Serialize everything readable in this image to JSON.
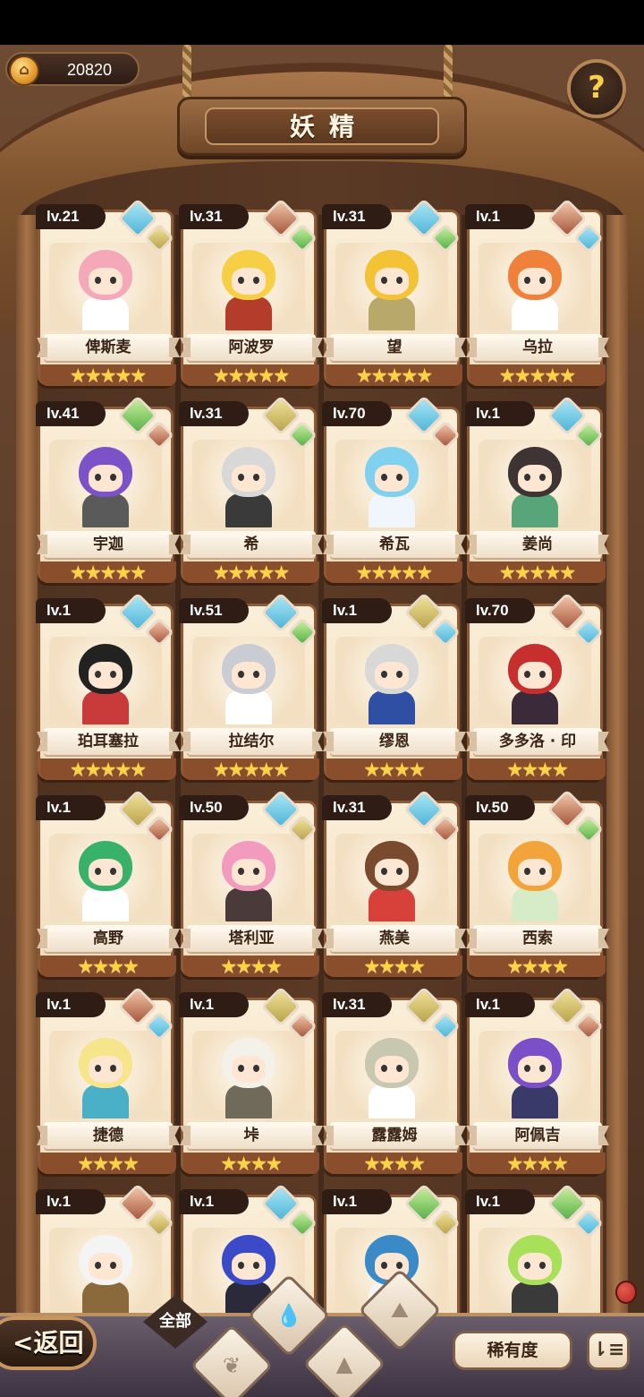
{
  "currency": {
    "value": "20820",
    "icon": "home-coin-icon"
  },
  "title": "妖精",
  "help": {
    "icon": "question-icon",
    "glyph": "?"
  },
  "cards": [
    {
      "lv": "lv.21",
      "name": "俾斯麦",
      "stars": 5,
      "elems": [
        "water",
        "earth"
      ],
      "hair": "#f4a8b8",
      "outfit": "#ffffff"
    },
    {
      "lv": "lv.31",
      "name": "阿波罗",
      "stars": 5,
      "elems": [
        "fire",
        "plant"
      ],
      "hair": "#f6cf45",
      "outfit": "#b33d2a"
    },
    {
      "lv": "lv.31",
      "name": "望",
      "stars": 5,
      "elems": [
        "water",
        "plant"
      ],
      "hair": "#f4c235",
      "outfit": "#b8a86a"
    },
    {
      "lv": "lv.1",
      "name": "乌拉",
      "stars": 5,
      "elems": [
        "fire",
        "water"
      ],
      "hair": "#f0813a",
      "outfit": "#ffffff"
    },
    {
      "lv": "lv.41",
      "name": "宇迦",
      "stars": 5,
      "elems": [
        "plant",
        "fire"
      ],
      "hair": "#7c52c8",
      "outfit": "#5a5a5a"
    },
    {
      "lv": "lv.31",
      "name": "希",
      "stars": 5,
      "elems": [
        "earth",
        "plant"
      ],
      "hair": "#d8d8d8",
      "outfit": "#3a3a3a"
    },
    {
      "lv": "lv.70",
      "name": "希瓦",
      "stars": 5,
      "elems": [
        "water",
        "fire"
      ],
      "hair": "#7fd1ef",
      "outfit": "#f0f6fb"
    },
    {
      "lv": "lv.1",
      "name": "姜尚",
      "stars": 5,
      "elems": [
        "water",
        "plant"
      ],
      "hair": "#3d3433",
      "outfit": "#58a57a"
    },
    {
      "lv": "lv.1",
      "name": "珀耳塞拉",
      "stars": 5,
      "elems": [
        "water",
        "fire"
      ],
      "hair": "#222222",
      "outfit": "#c93a3a"
    },
    {
      "lv": "lv.51",
      "name": "拉结尔",
      "stars": 5,
      "elems": [
        "water",
        "plant"
      ],
      "hair": "#c9ccd3",
      "outfit": "#ffffff"
    },
    {
      "lv": "lv.1",
      "name": "缪恩",
      "stars": 4,
      "elems": [
        "earth",
        "water"
      ],
      "hair": "#d8d8d8",
      "outfit": "#2e4fa3"
    },
    {
      "lv": "lv.70",
      "name": "多多洛 · 印",
      "stars": 4,
      "elems": [
        "fire",
        "water"
      ],
      "hair": "#c72e2e",
      "outfit": "#3a2a3a"
    },
    {
      "lv": "lv.1",
      "name": "高野",
      "stars": 4,
      "elems": [
        "earth",
        "fire"
      ],
      "hair": "#38b26b",
      "outfit": "#ffffff"
    },
    {
      "lv": "lv.50",
      "name": "塔利亚",
      "stars": 4,
      "elems": [
        "water",
        "earth"
      ],
      "hair": "#f29bbf",
      "outfit": "#4a3a3a"
    },
    {
      "lv": "lv.31",
      "name": "燕美",
      "stars": 4,
      "elems": [
        "water",
        "fire"
      ],
      "hair": "#7a4a2f",
      "outfit": "#d8403a"
    },
    {
      "lv": "lv.50",
      "name": "西索",
      "stars": 4,
      "elems": [
        "fire",
        "plant"
      ],
      "hair": "#f2a43a",
      "outfit": "#d6ecc8"
    },
    {
      "lv": "lv.1",
      "name": "捷德",
      "stars": 4,
      "elems": [
        "fire",
        "water"
      ],
      "hair": "#f6e58a",
      "outfit": "#4ab0c8"
    },
    {
      "lv": "lv.1",
      "name": "垰",
      "stars": 4,
      "elems": [
        "earth",
        "fire"
      ],
      "hair": "#f4f1e8",
      "outfit": "#6f6a5a"
    },
    {
      "lv": "lv.31",
      "name": "露露姆",
      "stars": 4,
      "elems": [
        "earth",
        "water"
      ],
      "hair": "#c8c7b0",
      "outfit": "#ffffff"
    },
    {
      "lv": "lv.1",
      "name": "阿佩吉",
      "stars": 4,
      "elems": [
        "earth",
        "fire"
      ],
      "hair": "#7a4fc8",
      "outfit": "#3a3a6a"
    },
    {
      "lv": "lv.1",
      "name": "",
      "stars": 0,
      "elems": [
        "fire",
        "earth"
      ],
      "hair": "#f4f4f4",
      "outfit": "#8a6a3a"
    },
    {
      "lv": "lv.1",
      "name": "",
      "stars": 0,
      "elems": [
        "water",
        "plant"
      ],
      "hair": "#3a4ac8",
      "outfit": "#2a2a3a"
    },
    {
      "lv": "lv.1",
      "name": "",
      "stars": 0,
      "elems": [
        "plant",
        "earth"
      ],
      "hair": "#3a8ac8",
      "outfit": "#f4f4f4"
    },
    {
      "lv": "lv.1",
      "name": "",
      "stars": 0,
      "elems": [
        "plant",
        "water"
      ],
      "hair": "#a8e05a",
      "outfit": "#3a3a3a"
    }
  ],
  "bottom": {
    "back_label": "返回",
    "back_glyph": "<",
    "filter_all_label": "全部",
    "filters": [
      "plant-icon",
      "water-icon",
      "earth-icon",
      "fire-icon"
    ],
    "rarity_label": "稀有度",
    "sort_icon": "sort-icon"
  },
  "colors": {
    "water": "#4fb5d8",
    "earth": "#b9a24b",
    "fire": "#a5563b",
    "plant": "#58b047",
    "star": "#ffd341"
  }
}
